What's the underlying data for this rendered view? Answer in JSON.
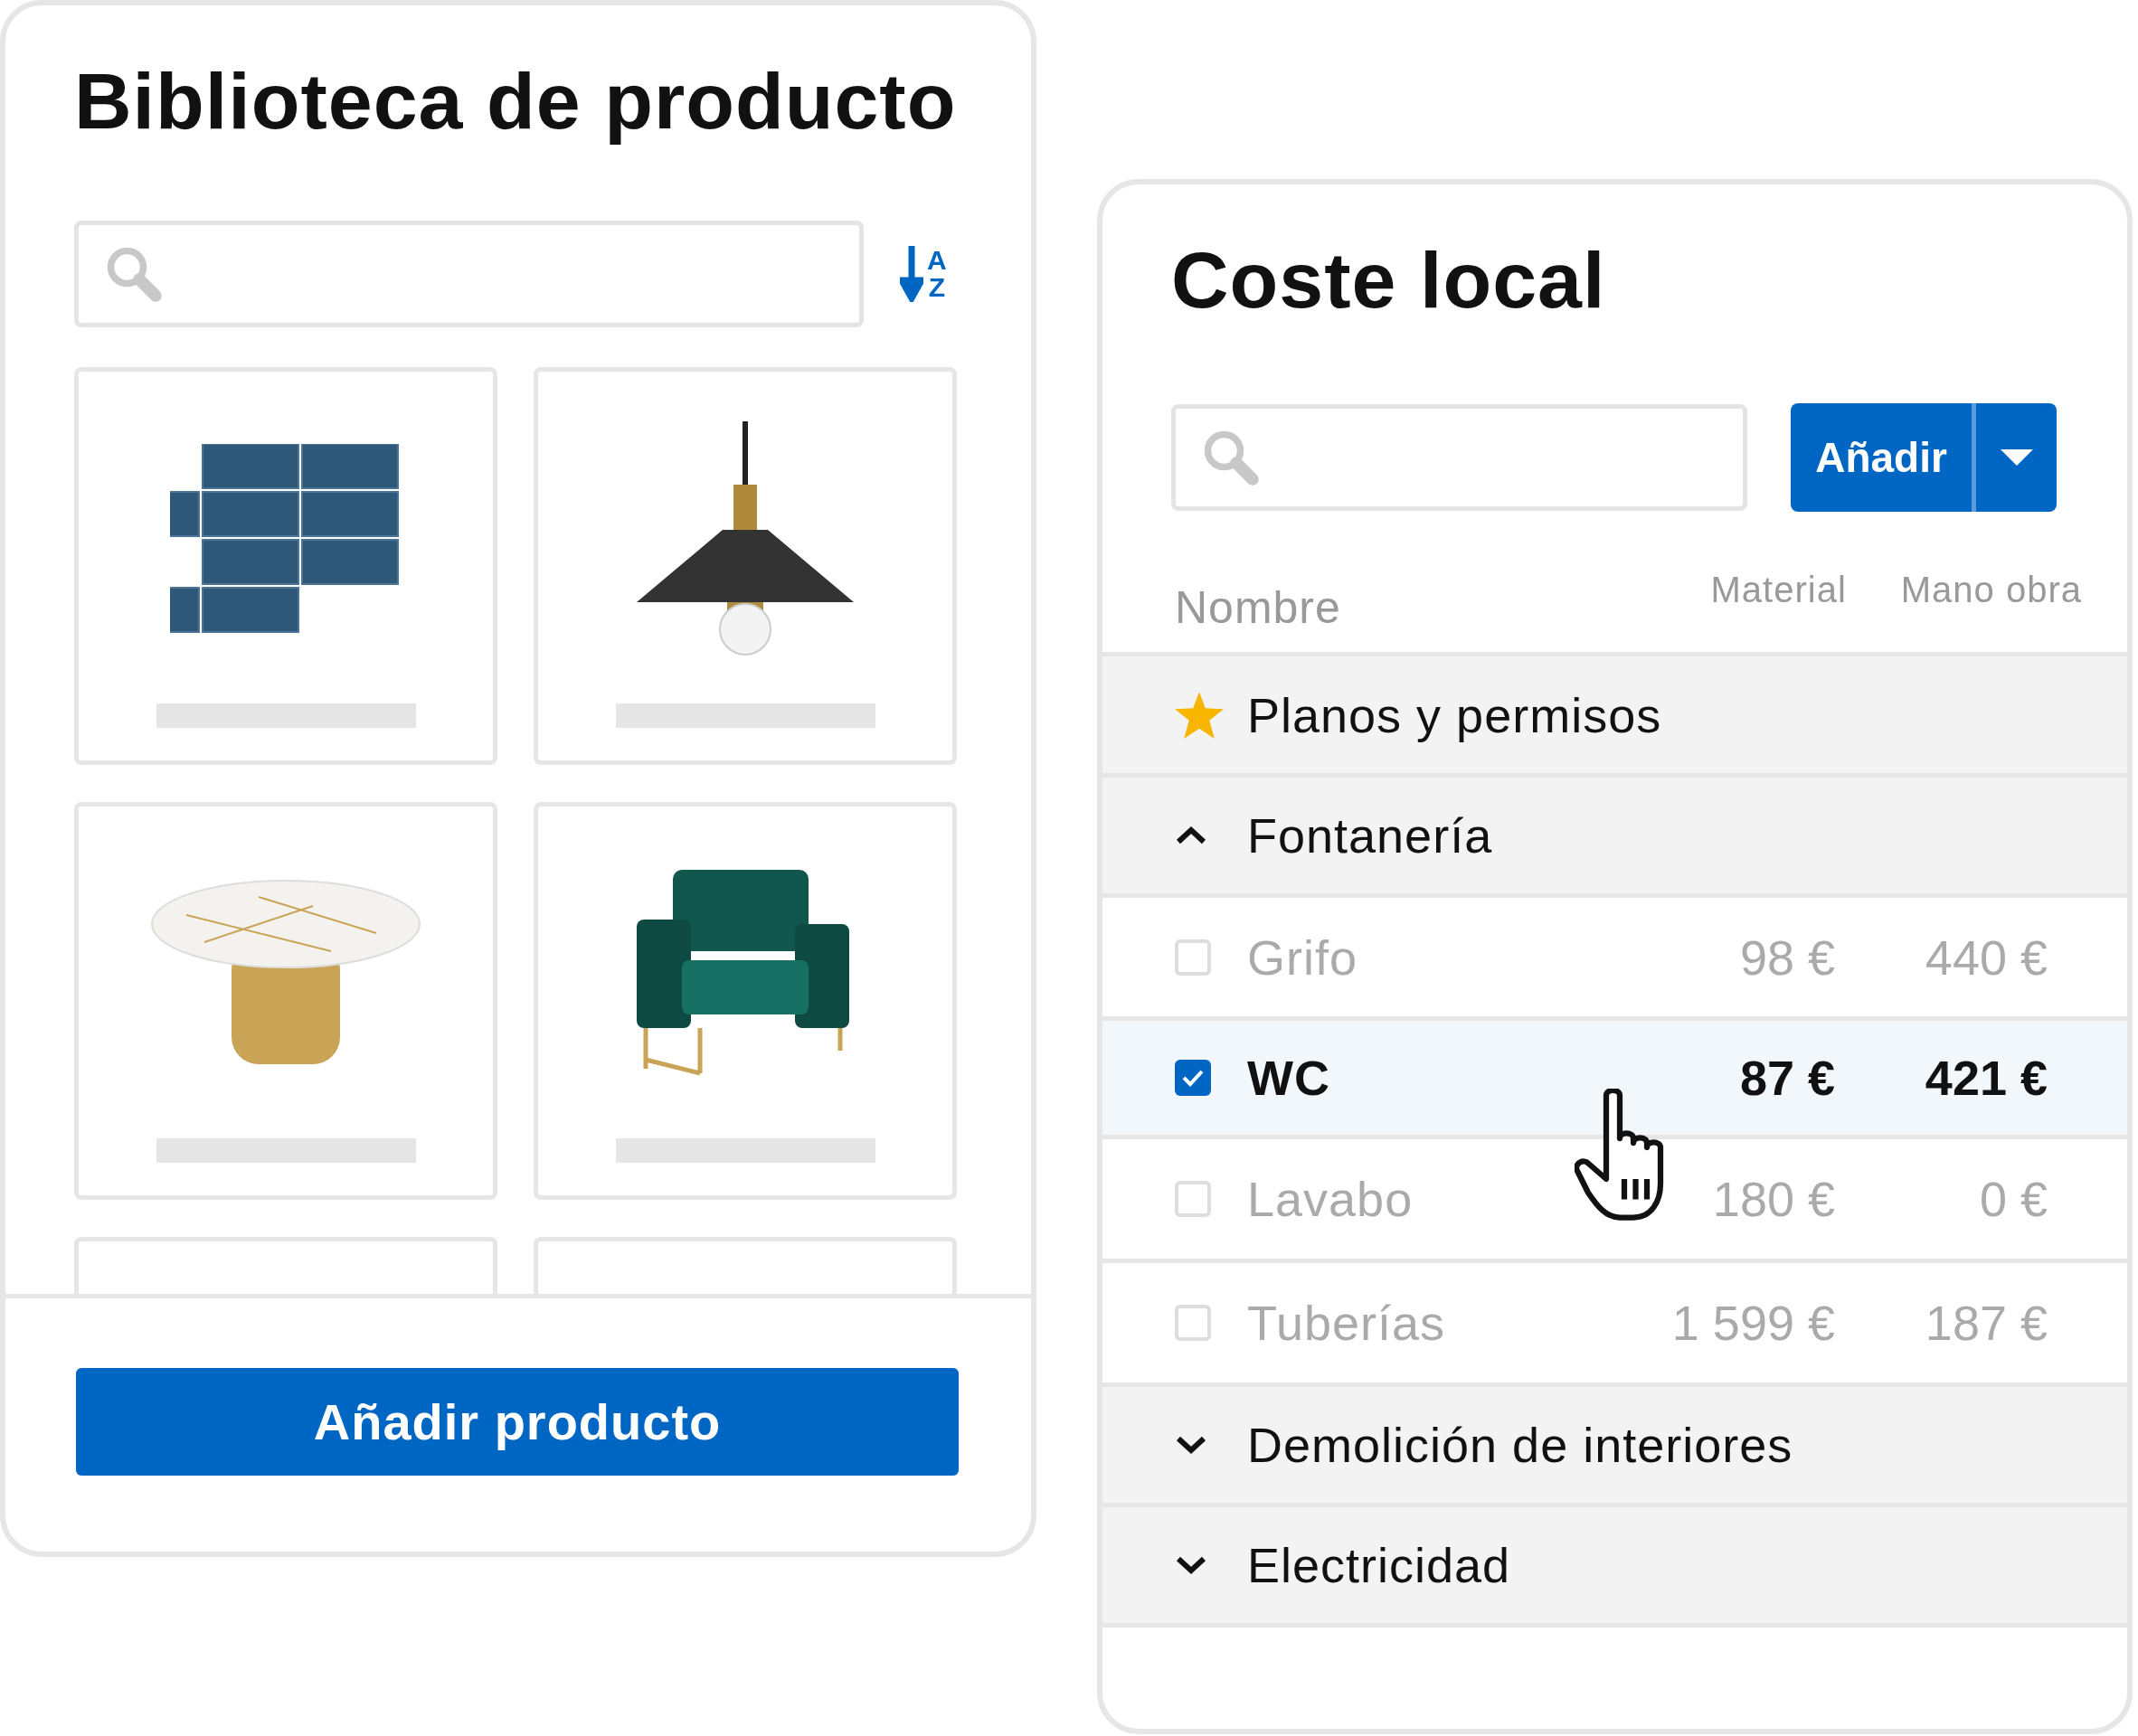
{
  "library": {
    "title": "Biblioteca de producto",
    "sort": {
      "from": "A",
      "to": "Z"
    },
    "products": [
      {
        "kind": "tiles"
      },
      {
        "kind": "lamp"
      },
      {
        "kind": "table"
      },
      {
        "kind": "chair"
      },
      {
        "kind": "partial"
      },
      {
        "kind": "partial"
      }
    ],
    "add_button": "Añadir producto"
  },
  "cost": {
    "title": "Coste local",
    "add_button": "Añadir",
    "columns": [
      "Nombre",
      "Material",
      "Mano obra"
    ],
    "groups": [
      {
        "kind": "starred",
        "name": "Planos y permisos"
      },
      {
        "kind": "group",
        "name": "Fontanería",
        "expanded": true,
        "items": [
          {
            "name": "Grifo",
            "material": "98 €",
            "labor": "440 €",
            "checked": false,
            "selected": false
          },
          {
            "name": "WC",
            "material": "87 €",
            "labor": "421 €",
            "checked": true,
            "selected": true
          },
          {
            "name": "Lavabo",
            "material": "180 €",
            "labor": "0 €",
            "checked": false,
            "selected": false
          },
          {
            "name": "Tuberías",
            "material": "1 599 €",
            "labor": "187 €",
            "checked": false,
            "selected": false
          }
        ]
      },
      {
        "kind": "group",
        "name": "Demolición de interiores",
        "expanded": false
      },
      {
        "kind": "group",
        "name": "Electricidad",
        "expanded": false
      }
    ]
  }
}
